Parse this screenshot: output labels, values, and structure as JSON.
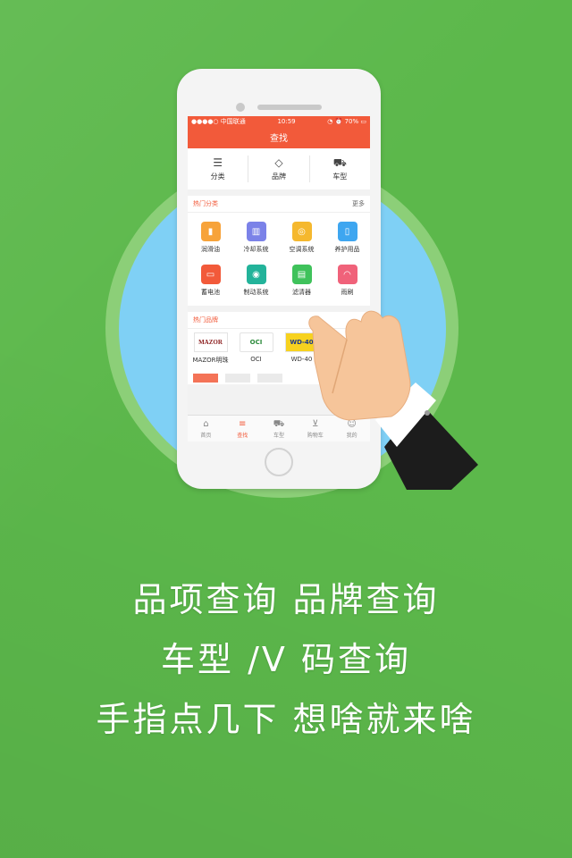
{
  "status_bar": {
    "carrier": "●●●●○ 中国联通",
    "time": "10:59",
    "battery": "70%"
  },
  "navbar": {
    "title": "查找"
  },
  "top_nav": [
    {
      "label": "分类",
      "icon": "list-icon"
    },
    {
      "label": "品牌",
      "icon": "tag-icon"
    },
    {
      "label": "车型",
      "icon": "car-icon"
    }
  ],
  "hot_categories": {
    "title": "热门分类",
    "more": "更多",
    "items": [
      {
        "label": "润滑油",
        "icon": "oil-icon",
        "color": "#f7a33a"
      },
      {
        "label": "冷却系统",
        "icon": "radiator-icon",
        "color": "#7b82e8"
      },
      {
        "label": "空调系统",
        "icon": "aircon-icon",
        "color": "#f5b82e"
      },
      {
        "label": "养护用品",
        "icon": "bottle-icon",
        "color": "#3ea6f0"
      },
      {
        "label": "蓄电池",
        "icon": "battery-icon",
        "color": "#f25a3a"
      },
      {
        "label": "制动系统",
        "icon": "brake-icon",
        "color": "#23b39a"
      },
      {
        "label": "滤清器",
        "icon": "filter-icon",
        "color": "#3fc25b"
      },
      {
        "label": "雨刷",
        "icon": "wiper-icon",
        "color": "#f0627a"
      }
    ]
  },
  "hot_brands": {
    "title": "热门品牌",
    "items": [
      {
        "label": "MAZOR明珠",
        "logo_text": "MAZOR"
      },
      {
        "label": "OCI",
        "logo_text": "OCI"
      },
      {
        "label": "WD-40",
        "logo_text": "WD-40"
      }
    ]
  },
  "tab_bar": [
    {
      "label": "首页",
      "icon": "home-icon",
      "active": false
    },
    {
      "label": "查找",
      "icon": "search-list-icon",
      "active": true
    },
    {
      "label": "车型",
      "icon": "car-icon",
      "active": false
    },
    {
      "label": "购物车",
      "icon": "cart-icon",
      "active": false
    },
    {
      "label": "我的",
      "icon": "user-icon",
      "active": false
    }
  ],
  "captions": {
    "line1": "品项查询 品牌查询",
    "line2": "车型 /V 码查询",
    "line3": "手指点几下 想啥就来啥"
  },
  "colors": {
    "background": "#5cb84b",
    "accent": "#f25a3a",
    "circle": "#7fd0f5"
  }
}
